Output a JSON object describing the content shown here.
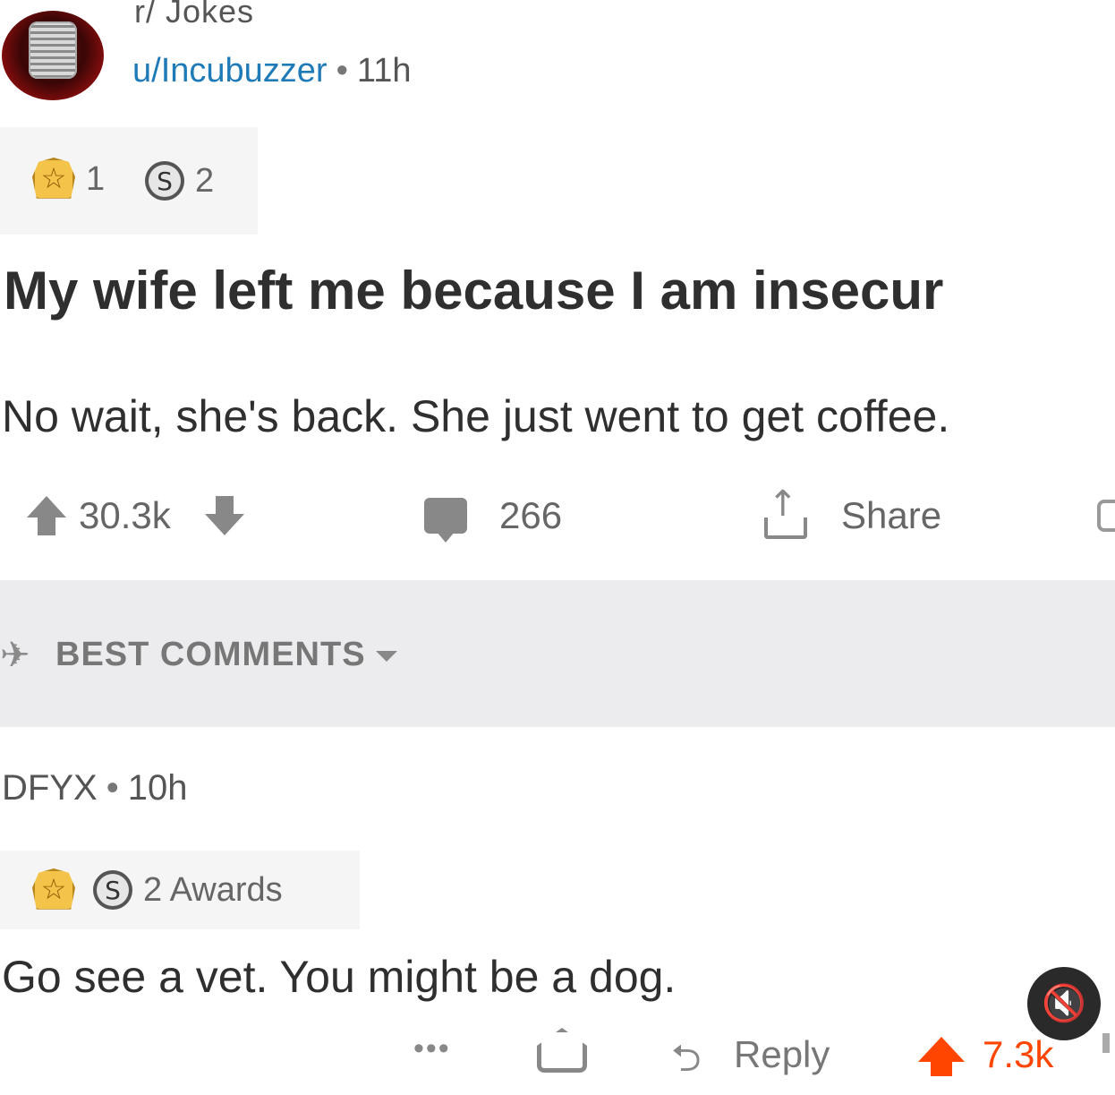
{
  "post": {
    "subreddit": "r/ Jokes",
    "username": "u/Incubuzzer",
    "separator": "•",
    "age": "11h",
    "awards": {
      "gold_count": "1",
      "silver_count": "2"
    },
    "title": "My wife left me because I am insecur",
    "body": "No wait, she's back. She just went to get coffee.",
    "actions": {
      "score": "30.3k",
      "comments": "266",
      "share_label": "Share"
    }
  },
  "sort": {
    "label": "BEST COMMENTS"
  },
  "comment": {
    "username": "DFYX",
    "separator": "•",
    "age": "10h",
    "awards_label": "2 Awards",
    "body": "Go see a vet. You might be a dog.",
    "actions": {
      "more": "•••",
      "reply_label": "Reply",
      "score": "7.3k"
    }
  },
  "icons": {
    "upvote": "arrow-up-icon",
    "downvote": "arrow-down-icon",
    "comments": "comment-icon",
    "share": "share-icon",
    "sort": "rocket-icon",
    "mute": "muted-speaker-icon"
  },
  "colors": {
    "accent_orange": "#ff4500",
    "link_blue": "#1f7bb8",
    "band_gray": "#ececef"
  }
}
